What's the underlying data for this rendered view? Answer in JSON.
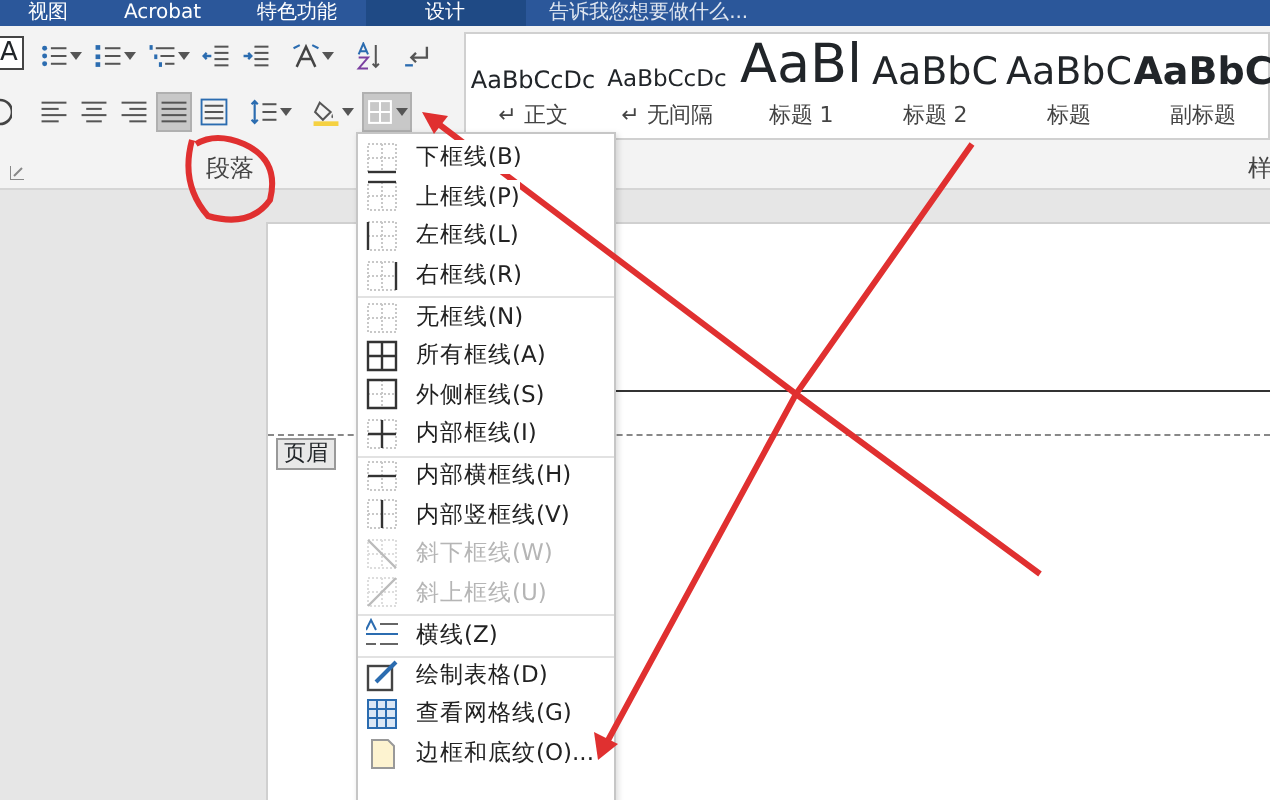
{
  "ribbon_tabs": [
    {
      "label": "视图",
      "selected": false
    },
    {
      "label": "Acrobat",
      "selected": false
    },
    {
      "label": "特色功能",
      "selected": false
    },
    {
      "label": "设计",
      "selected": true
    }
  ],
  "tell_me": {
    "placeholder": "告诉我您想要做什么..."
  },
  "font_group_edge": {
    "letter": "A"
  },
  "paragraph_group": {
    "label": "段落",
    "row_1": [
      {
        "kind": "bullets",
        "dropdown": true,
        "selected": false
      },
      {
        "kind": "numbering",
        "dropdown": true,
        "selected": false
      },
      {
        "kind": "multilevel",
        "dropdown": true,
        "selected": false
      },
      {
        "kind": "outdent",
        "dropdown": false,
        "selected": false
      },
      {
        "kind": "indent",
        "dropdown": false,
        "selected": false
      },
      {
        "kind": "asian-layout",
        "dropdown": true,
        "selected": false
      },
      {
        "kind": "sort",
        "dropdown": false,
        "selected": false
      },
      {
        "kind": "marks",
        "dropdown": false,
        "selected": false
      }
    ],
    "row_2": [
      {
        "kind": "align-left",
        "dropdown": false,
        "selected": false
      },
      {
        "kind": "align-center",
        "dropdown": false,
        "selected": false
      },
      {
        "kind": "align-right",
        "dropdown": false,
        "selected": false
      },
      {
        "kind": "justify",
        "dropdown": false,
        "selected": true
      },
      {
        "kind": "distribute",
        "dropdown": false,
        "selected": false
      },
      {
        "kind": "line-spacing",
        "dropdown": true,
        "selected": false
      },
      {
        "kind": "shading",
        "dropdown": true,
        "selected": false
      },
      {
        "kind": "borders",
        "dropdown": true,
        "selected": true
      }
    ]
  },
  "styles_gallery": [
    {
      "kind": "normal",
      "preview": "AaBbCcDc",
      "label": "↵ 正文"
    },
    {
      "kind": "no-spacing",
      "preview": "AaBbCcDc",
      "label": "↵ 无间隔"
    },
    {
      "kind": "heading-1",
      "preview": "AaBl",
      "label": "标题 1"
    },
    {
      "kind": "heading-2",
      "preview": "AaBbC",
      "label": "标题 2"
    },
    {
      "kind": "title",
      "preview": "AaBbC",
      "label": "标题"
    },
    {
      "kind": "subtitle",
      "preview": "AaBbC",
      "label": "副标题"
    }
  ],
  "styles_group_label": "样",
  "header_tag": "页眉",
  "borders_menu": [
    {
      "kind": "bottom",
      "label": "下框线(B)",
      "disabled": false,
      "separator_before": false
    },
    {
      "kind": "top",
      "label": "上框线(P)",
      "disabled": false,
      "separator_before": false
    },
    {
      "kind": "left",
      "label": "左框线(L)",
      "disabled": false,
      "separator_before": false
    },
    {
      "kind": "right",
      "label": "右框线(R)",
      "disabled": false,
      "separator_before": false
    },
    {
      "kind": "none",
      "label": "无框线(N)",
      "disabled": false,
      "separator_before": true
    },
    {
      "kind": "all",
      "label": "所有框线(A)",
      "disabled": false,
      "separator_before": false
    },
    {
      "kind": "outside",
      "label": "外侧框线(S)",
      "disabled": false,
      "separator_before": false
    },
    {
      "kind": "inside",
      "label": "内部框线(I)",
      "disabled": false,
      "separator_before": false
    },
    {
      "kind": "inside-h",
      "label": "内部横框线(H)",
      "disabled": false,
      "separator_before": true
    },
    {
      "kind": "inside-v",
      "label": "内部竖框线(V)",
      "disabled": false,
      "separator_before": false
    },
    {
      "kind": "diag-down",
      "label": "斜下框线(W)",
      "disabled": true,
      "separator_before": false
    },
    {
      "kind": "diag-up",
      "label": "斜上框线(U)",
      "disabled": true,
      "separator_before": false
    },
    {
      "kind": "hline",
      "label": "横线(Z)",
      "disabled": false,
      "separator_before": true
    },
    {
      "kind": "draw-table",
      "label": "绘制表格(D)",
      "disabled": false,
      "separator_before": true
    },
    {
      "kind": "gridlines",
      "label": "查看网格线(G)",
      "disabled": false,
      "separator_before": false
    },
    {
      "kind": "shading",
      "label": "边框和底纹(O)...",
      "disabled": false,
      "separator_before": false
    }
  ]
}
